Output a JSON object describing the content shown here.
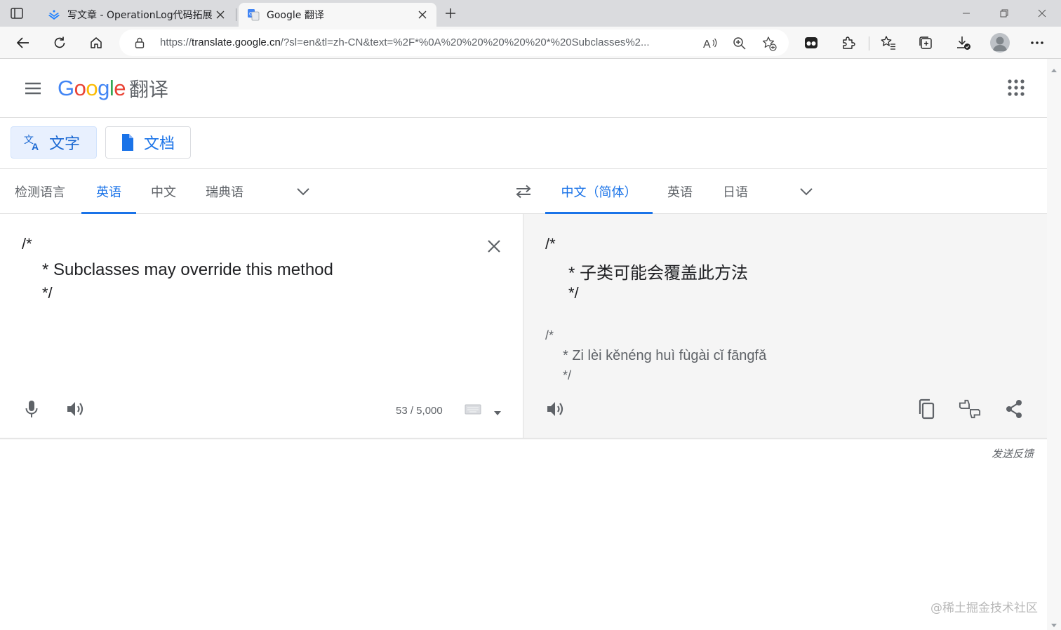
{
  "browser": {
    "tabs": [
      {
        "title": "写文章 - OperationLog代码拓展",
        "active": false
      },
      {
        "title": "Google 翻译",
        "active": true
      }
    ],
    "url_prefix": "https://",
    "url_host": "translate.google.cn",
    "url_rest": "/?sl=en&tl=zh-CN&text=%2F*%0A%20%20%20%20%20*%20Subclasses%2..."
  },
  "header": {
    "logo_letters": [
      {
        "ch": "G",
        "color": "#4285f4"
      },
      {
        "ch": "o",
        "color": "#ea4335"
      },
      {
        "ch": "o",
        "color": "#fbbc05"
      },
      {
        "ch": "g",
        "color": "#4285f4"
      },
      {
        "ch": "l",
        "color": "#34a853"
      },
      {
        "ch": "e",
        "color": "#ea4335"
      }
    ],
    "product": "翻译"
  },
  "modes": {
    "text_label": "文字",
    "docs_label": "文档"
  },
  "source_langs": {
    "detect": "检测语言",
    "english": "英语",
    "chinese": "中文",
    "swedish": "瑞典语",
    "selected": "英语"
  },
  "target_langs": {
    "chinese_simplified": "中文（简体）",
    "english": "英语",
    "japanese": "日语",
    "selected": "中文（简体）"
  },
  "source": {
    "lines": [
      "/*",
      "* Subclasses may override this method",
      "*/"
    ],
    "char_count": "53 / 5,000"
  },
  "target": {
    "lines": [
      "/*",
      "* 子类可能会覆盖此方法",
      "*/"
    ],
    "romanization": [
      "/*",
      "* Zi lèi kěnéng huì fùgài cǐ fāngfǎ",
      "*/"
    ]
  },
  "footer": {
    "feedback": "发送反馈",
    "watermark": "@稀土掘金技术社区"
  },
  "colors": {
    "accent": "#1a73e8",
    "icon_gray": "#5f6368"
  }
}
